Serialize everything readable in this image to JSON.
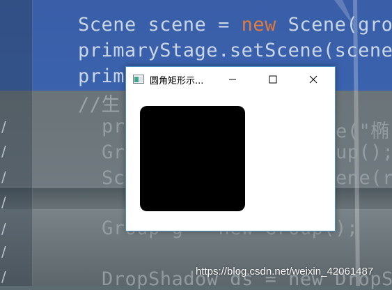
{
  "window": {
    "title": "圆角矩形示...",
    "minimize_glyph": "—",
    "close_glyph": "✕"
  },
  "shape": {
    "type": "rounded-rectangle",
    "fill": "#000000"
  },
  "background": {
    "code_lines": [
      "Scene scene = ",
      "new",
      " Scene(gro",
      "primaryStage.setScene(scene",
      "prim",
      "//生",
      "pr",
      "e(\"椭",
      "Gr",
      "up();",
      "Sc",
      "ene(r",
      "Group g = new Group();",
      "DropShadow ds = new DropS"
    ],
    "gutter_marks": [
      "/",
      "/",
      "/",
      "/",
      "/",
      "/",
      "/"
    ],
    "keyword_color": "#e07a3e"
  },
  "watermark": "https://blog.csdn.net/weixin_42061487"
}
